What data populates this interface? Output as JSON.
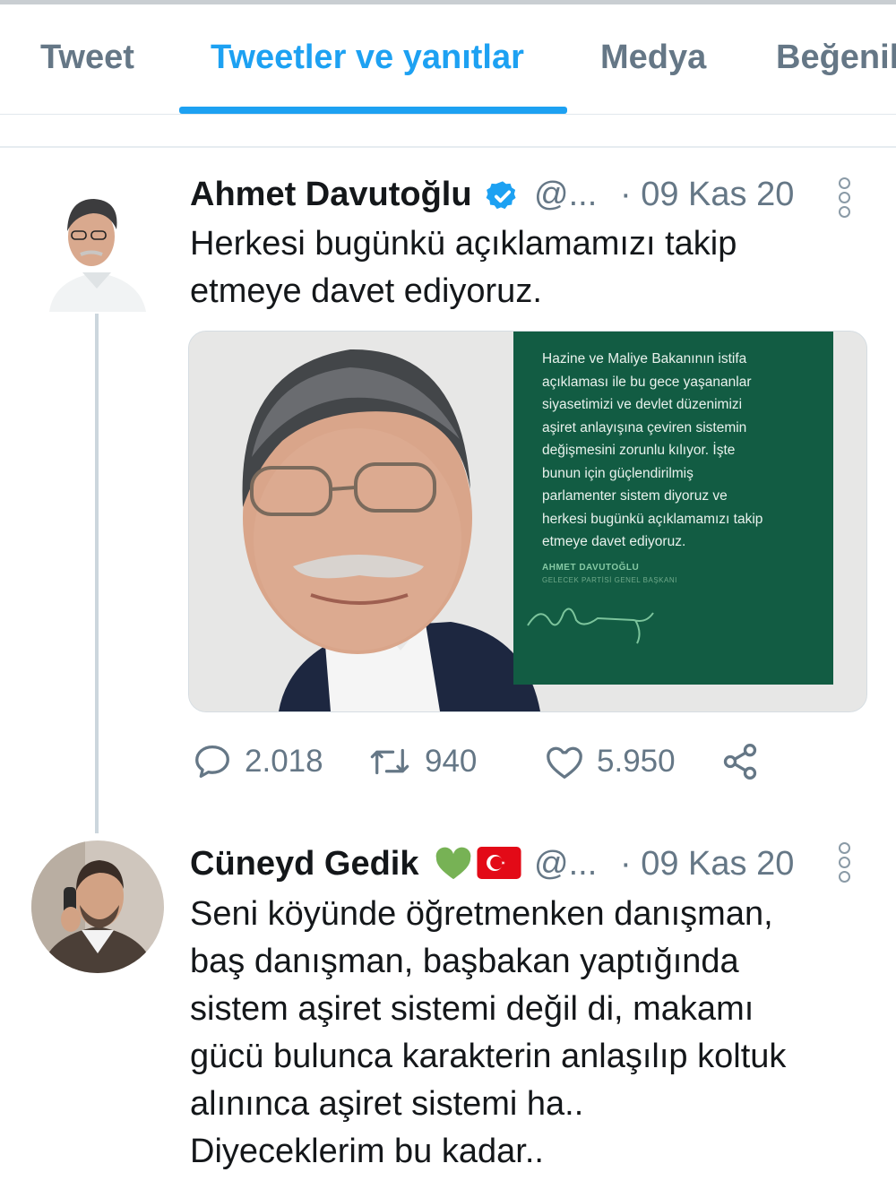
{
  "tabs": [
    {
      "label": "Tweet",
      "active": false
    },
    {
      "label": "Tweetler ve yanıtlar",
      "active": true
    },
    {
      "label": "Medya",
      "active": false
    },
    {
      "label": "Beğeniler",
      "active": false
    }
  ],
  "accent_color": "#1da1f2",
  "tweets": [
    {
      "author": "Ahmet Davutoğlu",
      "verified": true,
      "handle": "@...",
      "date": "· 09 Kas 20",
      "lines": [
        "Herkesi bugünkü açıklamamızı takip",
        "etmeye davet ediyoruz."
      ],
      "media": {
        "quote_lines": [
          "Hazine ve Maliye Bakanının istifa",
          "açıklaması ile bu gece yaşananlar",
          "siyasetimizi ve devlet düzenimizi",
          "aşiret anlayışına çeviren sistemin",
          "değişmesini zorunlu kılıyor. İşte",
          "bunun için güçlendirilmiş",
          "parlamenter sistem diyoruz ve",
          "herkesi bugünkü açıklamamızı takip",
          "etmeye davet ediyoruz."
        ],
        "signature_name": "AHMET DAVUTOĞLU",
        "signature_title": "GELECEK PARTİSİ GENEL BAŞKANI",
        "card_color": "#125c43"
      },
      "actions": {
        "replies": "2.018",
        "retweets": "940",
        "likes": "5.950"
      }
    },
    {
      "author": "Cüneyd Gedik",
      "emoji": "💚🇹🇷",
      "handle": "@...",
      "date": "· 09 Kas 20",
      "lines": [
        "Seni köyünde öğretmenken danışman,",
        "baş danışman, başbakan yaptığında",
        "sistem aşiret sistemi değil di, makamı",
        "gücü bulunca karakterin anlaşılıp koltuk",
        "alınınca aşiret sistemi ha..",
        "Diyeceklerim bu kadar.."
      ]
    }
  ]
}
